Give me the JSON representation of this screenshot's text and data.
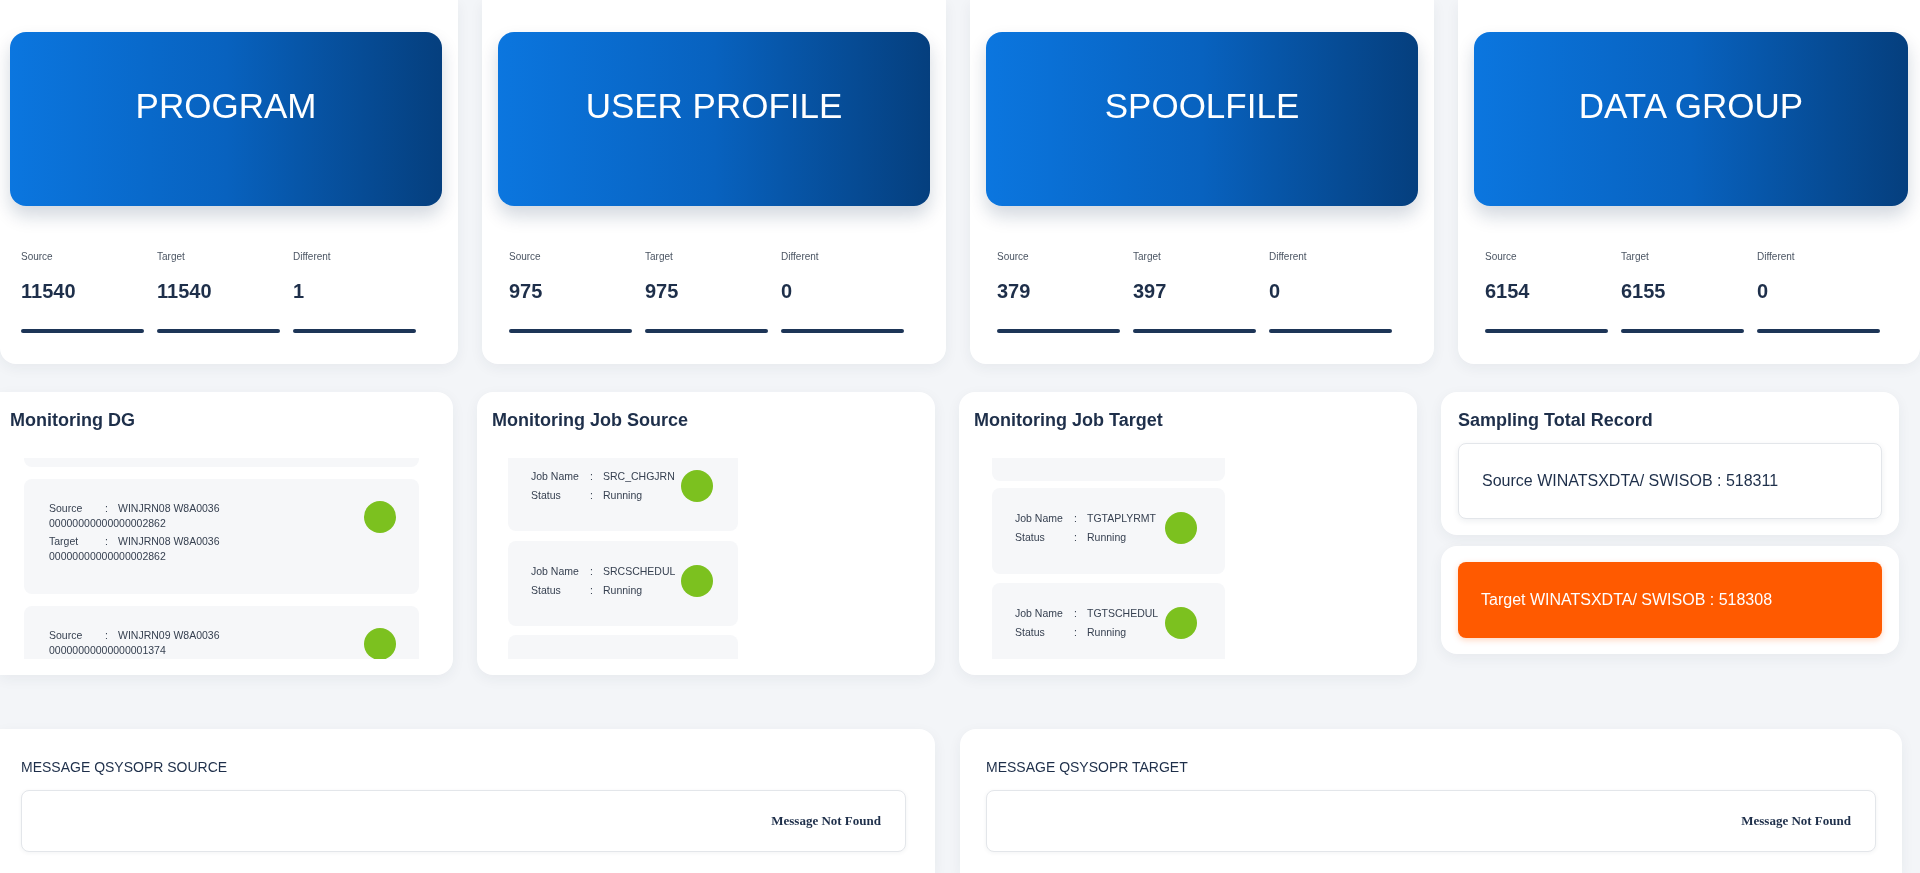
{
  "summary_cards": [
    {
      "title": "PROGRAM",
      "stats": [
        {
          "label": "Source",
          "value": "11540"
        },
        {
          "label": "Target",
          "value": "11540"
        },
        {
          "label": "Different",
          "value": "1"
        }
      ]
    },
    {
      "title": "USER PROFILE",
      "stats": [
        {
          "label": "Source",
          "value": "975"
        },
        {
          "label": "Target",
          "value": "975"
        },
        {
          "label": "Different",
          "value": "0"
        }
      ]
    },
    {
      "title": "SPOOLFILE",
      "stats": [
        {
          "label": "Source",
          "value": "379"
        },
        {
          "label": "Target",
          "value": "397"
        },
        {
          "label": "Different",
          "value": "0"
        }
      ]
    },
    {
      "title": "DATA GROUP",
      "stats": [
        {
          "label": "Source",
          "value": "6154"
        },
        {
          "label": "Target",
          "value": "6155"
        },
        {
          "label": "Different",
          "value": "0"
        }
      ]
    }
  ],
  "monitoring_dg": {
    "title": "Monitoring DG",
    "items": [
      {
        "color": "#7cc11f",
        "rows": [
          {
            "label": "Source",
            "separator": ":",
            "value": "WINJRN08 W8A0036",
            "value_line_2": "00000000000000002862"
          },
          {
            "label": "Target",
            "separator": ":",
            "value": "WINJRN08 W8A0036",
            "value_line_2": "00000000000000002862"
          }
        ]
      },
      {
        "color": "#7cc11f",
        "rows": [
          {
            "label": "Source",
            "separator": ":",
            "value": "WINJRN09 W8A0036",
            "value_line_2": "00000000000000001374"
          }
        ]
      }
    ]
  },
  "monitoring_job_source": {
    "title": "Monitoring Job Source",
    "jobs": [
      {
        "color": "#7cc11f",
        "fields": [
          {
            "label": "Job Name",
            "separator": ":",
            "value": "SRC_CHGJRN"
          },
          {
            "label": "Status",
            "separator": ":",
            "value": "Running"
          }
        ]
      },
      {
        "color": "#7cc11f",
        "fields": [
          {
            "label": "Job Name",
            "separator": ":",
            "value": "SRCSCHEDUL"
          },
          {
            "label": "Status",
            "separator": ":",
            "value": "Running"
          }
        ]
      }
    ]
  },
  "monitoring_job_target": {
    "title": "Monitoring Job Target",
    "jobs": [
      {
        "color": "#7cc11f",
        "fields": [
          {
            "label": "Job Name",
            "separator": ":",
            "value": "TGTAPLYRMT"
          },
          {
            "label": "Status",
            "separator": ":",
            "value": "Running"
          }
        ]
      },
      {
        "color": "#7cc11f",
        "fields": [
          {
            "label": "Job Name",
            "separator": ":",
            "value": "TGTSCHEDUL"
          },
          {
            "label": "Status",
            "separator": ":",
            "value": "Running"
          }
        ]
      }
    ]
  },
  "sampling_total_record": {
    "title": "Sampling Total Record",
    "records": [
      {
        "text": "Source WINATSXDTA/ SWISOB : 518311",
        "alert": false
      },
      {
        "text": "Target WINATSXDTA/ SWISOB : 518308",
        "alert": true
      }
    ]
  },
  "messages": [
    {
      "title": "MESSAGE QSYSOPR SOURCE",
      "text": "Message Not Found"
    },
    {
      "title": "MESSAGE QSYSOPR TARGET",
      "text": "Message Not Found"
    }
  ]
}
